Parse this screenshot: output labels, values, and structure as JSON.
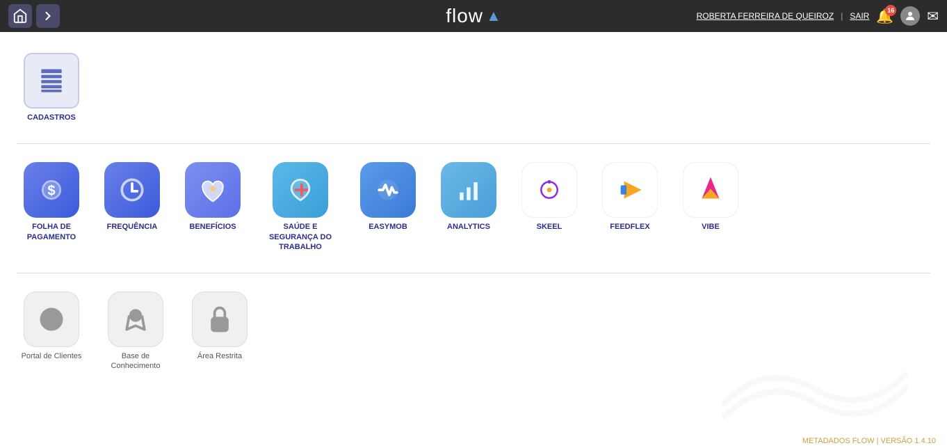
{
  "app": {
    "title": "flow",
    "logo_icon": "▲"
  },
  "header": {
    "user_name": "ROBERTA FERREIRA DE QUEIROZ",
    "separator": "|",
    "sair_label": "SAIR",
    "bell_count": "16"
  },
  "sections": [
    {
      "id": "cadastros",
      "items": [
        {
          "id": "cadastros",
          "label": "CADASTROS",
          "color_class": "icon-cadastros",
          "normal_case": false
        }
      ]
    },
    {
      "id": "main-apps",
      "items": [
        {
          "id": "folha",
          "label": "FOLHA DE PAGAMENTO",
          "color_class": "icon-folha",
          "normal_case": false
        },
        {
          "id": "frequencia",
          "label": "FREQUÊNCIA",
          "color_class": "icon-frequencia",
          "normal_case": false
        },
        {
          "id": "beneficios",
          "label": "BENEFÍCIOS",
          "color_class": "icon-beneficios",
          "normal_case": false
        },
        {
          "id": "saude",
          "label": "SAÚDE E SEGURANÇA DO TRABALHO",
          "color_class": "icon-saude",
          "normal_case": false
        },
        {
          "id": "easymob",
          "label": "EASYMOB",
          "color_class": "icon-easymob",
          "normal_case": false
        },
        {
          "id": "analytics",
          "label": "ANALYTICS",
          "color_class": "icon-analytics",
          "normal_case": false
        },
        {
          "id": "skeel",
          "label": "SKEEL",
          "color_class": "icon-skeel",
          "normal_case": false
        },
        {
          "id": "feedflex",
          "label": "FEEDFLEX",
          "color_class": "icon-feedflex",
          "normal_case": false
        },
        {
          "id": "vibe",
          "label": "VIBE",
          "color_class": "icon-vibe",
          "normal_case": false
        }
      ]
    },
    {
      "id": "bottom-apps",
      "items": [
        {
          "id": "portal",
          "label": "Portal de Clientes",
          "color_class": "icon-gray",
          "normal_case": true
        },
        {
          "id": "base",
          "label": "Base de Conhecimento",
          "color_class": "icon-gray",
          "normal_case": true
        },
        {
          "id": "area",
          "label": "Área Restrita",
          "color_class": "icon-gray",
          "normal_case": true
        }
      ]
    }
  ],
  "footer": {
    "text": "METADADOS FLOW | VERSÃO 1.4.10"
  }
}
